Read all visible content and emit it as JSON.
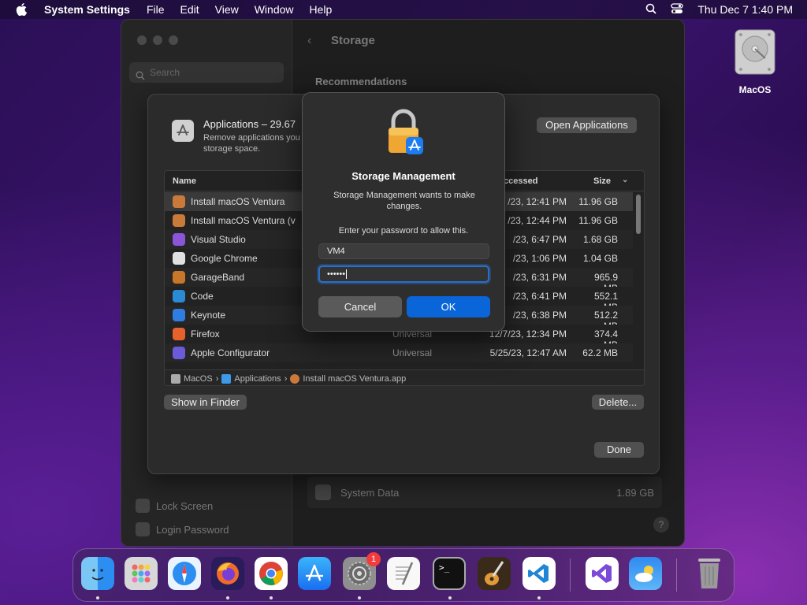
{
  "menubar": {
    "app": "System Settings",
    "items": [
      "File",
      "Edit",
      "View",
      "Window",
      "Help"
    ],
    "clock": "Thu Dec 7  1:40 PM"
  },
  "desktop": {
    "icon_label": "MacOS"
  },
  "window": {
    "title": "Storage",
    "search_placeholder": "Search",
    "section": "Recommendations",
    "sidebar_bottom": [
      "Lock Screen",
      "Login Password"
    ],
    "system_data": {
      "label": "System Data",
      "size": "1.89 GB"
    },
    "help": "?"
  },
  "sheet": {
    "title": "Applications – 29.67",
    "desc": "Remove applications you storage space.",
    "open_btn": "Open Applications",
    "columns": {
      "name": "Name",
      "accessed": "ccessed",
      "size": "Size"
    },
    "rows": [
      {
        "name": "Install macOS Ventura",
        "kind": "",
        "accessed": "/23, 12:41 PM",
        "size": "11.96 GB",
        "color": "#c97a3b"
      },
      {
        "name": "Install macOS Ventura (v",
        "kind": "",
        "accessed": "/23, 12:44 PM",
        "size": "11.96 GB",
        "color": "#c97a3b"
      },
      {
        "name": "Visual Studio",
        "kind": "",
        "accessed": "/23, 6:47 PM",
        "size": "1.68 GB",
        "color": "#8a55d6"
      },
      {
        "name": "Google Chrome",
        "kind": "",
        "accessed": "/23, 1:06 PM",
        "size": "1.04 GB",
        "color": "#e0e0e0"
      },
      {
        "name": "GarageBand",
        "kind": "",
        "accessed": "/23, 6:31 PM",
        "size": "965.9 MB",
        "color": "#c8762a"
      },
      {
        "name": "Code",
        "kind": "",
        "accessed": "/23, 6:41 PM",
        "size": "552.1 MB",
        "color": "#2a8ad4"
      },
      {
        "name": "Keynote",
        "kind": "",
        "accessed": "/23, 6:38 PM",
        "size": "512.2 MB",
        "color": "#2f7de0"
      },
      {
        "name": "Firefox",
        "kind": "Universal",
        "accessed": "12/7/23, 12:34 PM",
        "size": "374.4 MB",
        "color": "#e5622c"
      },
      {
        "name": "Apple Configurator",
        "kind": "Universal",
        "accessed": "5/25/23, 12:47 AM",
        "size": "62.2 MB",
        "color": "#6b5bd8"
      }
    ],
    "breadcrumb": [
      "MacOS",
      "Applications",
      "Install macOS Ventura.app"
    ],
    "show_in_finder": "Show in Finder",
    "delete": "Delete...",
    "done": "Done"
  },
  "dialog": {
    "title": "Storage Management",
    "desc": "Storage Management wants to make changes.",
    "prompt": "Enter your password to allow this.",
    "username": "VM4",
    "password_mask": "••••••",
    "cancel": "Cancel",
    "ok": "OK"
  },
  "dock": {
    "settings_badge": "1"
  }
}
